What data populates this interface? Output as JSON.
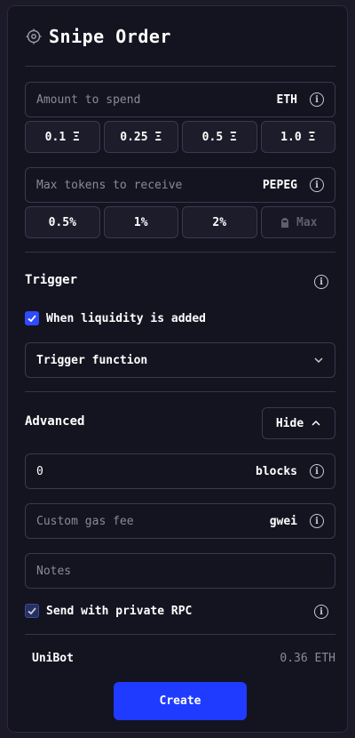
{
  "header": {
    "title": "Snipe Order",
    "icon": "crosshair-icon"
  },
  "amount": {
    "placeholder": "Amount to spend",
    "unit": "ETH",
    "presets": [
      "0.1 Ξ",
      "0.25 Ξ",
      "0.5 Ξ",
      "1.0 Ξ"
    ]
  },
  "max_tokens": {
    "placeholder": "Max tokens to receive",
    "unit": "PEPEG",
    "presets": [
      "0.5%",
      "1%",
      "2%"
    ],
    "max_label": "Max",
    "max_icon": "gorilla-icon"
  },
  "trigger": {
    "title": "Trigger",
    "liquidity_label": "When liquidity is added",
    "liquidity_checked": true,
    "function_label": "Trigger function"
  },
  "advanced": {
    "title": "Advanced",
    "hide_label": "Hide",
    "blocks_value": "0",
    "blocks_unit": "blocks",
    "gas_placeholder": "Custom gas fee",
    "gas_unit": "gwei",
    "notes_placeholder": "Notes",
    "private_rpc_label": "Send with private RPC",
    "private_rpc_checked": true
  },
  "footer": {
    "bot_name": "UniBot",
    "balance": "0.36 ETH",
    "create_label": "Create"
  },
  "colors": {
    "accent": "#1f3bff",
    "panel": "#141320",
    "border": "#3a394f"
  }
}
